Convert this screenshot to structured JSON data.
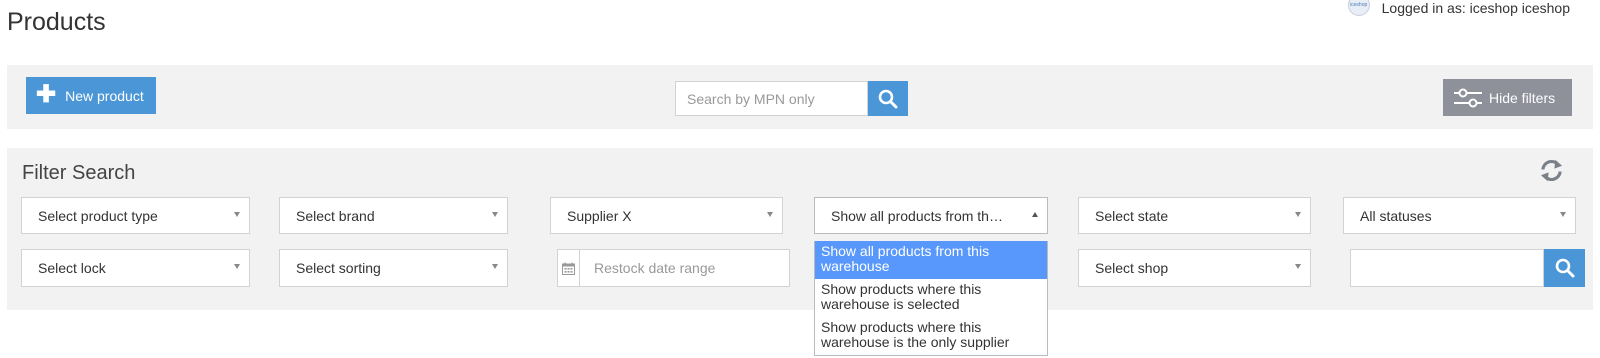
{
  "page": {
    "title": "Products"
  },
  "user": {
    "logged_in_text": "Logged in as: iceshop iceshop",
    "avatar_text": "iceshop"
  },
  "toolbar": {
    "new_product_label": "New product",
    "mpn_placeholder": "Search by MPN only",
    "hide_filters_label": "Hide filters"
  },
  "filters": {
    "title": "Filter Search",
    "row1": {
      "product_type": "Select product type",
      "brand": "Select brand",
      "supplier": "Supplier X",
      "warehouse": "Show all products from th…",
      "state": "Select state",
      "status": "All statuses"
    },
    "row2": {
      "lock": "Select lock",
      "sorting": "Select sorting",
      "restock_placeholder": "Restock date range",
      "shop": "Select shop"
    },
    "warehouse_options": [
      "Show all products from this warehouse",
      "Show products where this warehouse is selected",
      "Show products where this warehouse is the only supplier"
    ]
  },
  "colors": {
    "primary": "#4a96d6",
    "hide_button": "#8e909a",
    "panel_bg": "#f2f2f2",
    "selected_option": "#5897fb"
  }
}
